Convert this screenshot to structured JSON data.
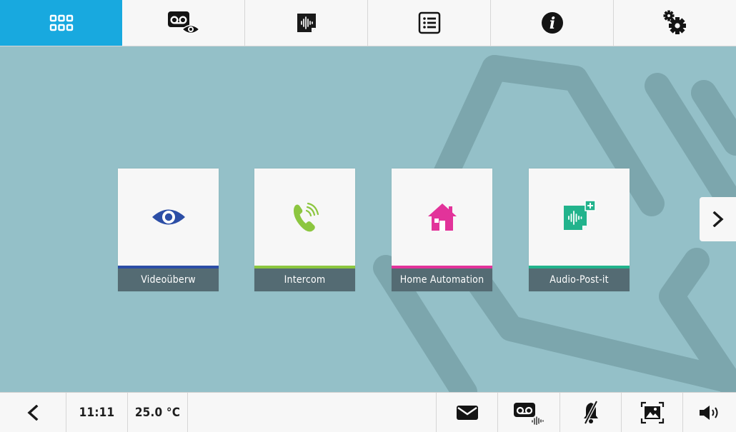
{
  "topbar": {
    "tabs": [
      {
        "name": "apps-grid",
        "icon": "apps-grid-icon",
        "active": true
      },
      {
        "name": "video-memory",
        "icon": "video-memory-icon",
        "active": false
      },
      {
        "name": "audio-memo",
        "icon": "audio-memo-icon",
        "active": false
      },
      {
        "name": "list",
        "icon": "list-icon",
        "active": false
      },
      {
        "name": "info",
        "icon": "info-icon",
        "active": false
      },
      {
        "name": "settings",
        "icon": "settings-icon",
        "active": false
      }
    ],
    "active_color": "#18a9df"
  },
  "main": {
    "tiles": [
      {
        "label": "Videoüberw",
        "icon": "eye-icon",
        "accent": "#2c4ea6"
      },
      {
        "label": "Intercom",
        "icon": "phone-ringing-icon",
        "accent": "#8cc63f"
      },
      {
        "label": "Home Automation",
        "icon": "home-icon",
        "accent": "#e2339a"
      },
      {
        "label": "Audio-Post-it",
        "icon": "audio-postit-icon",
        "accent": "#22b38c"
      }
    ],
    "next_icon": "chevron-right-icon"
  },
  "statusbar": {
    "back_icon": "chevron-left-icon",
    "time": "11:11",
    "temperature": "25.0 °C",
    "icons": [
      "message-icon",
      "answering-machine-icon",
      "bell-muted-icon",
      "picture-icon",
      "speaker-icon"
    ]
  }
}
